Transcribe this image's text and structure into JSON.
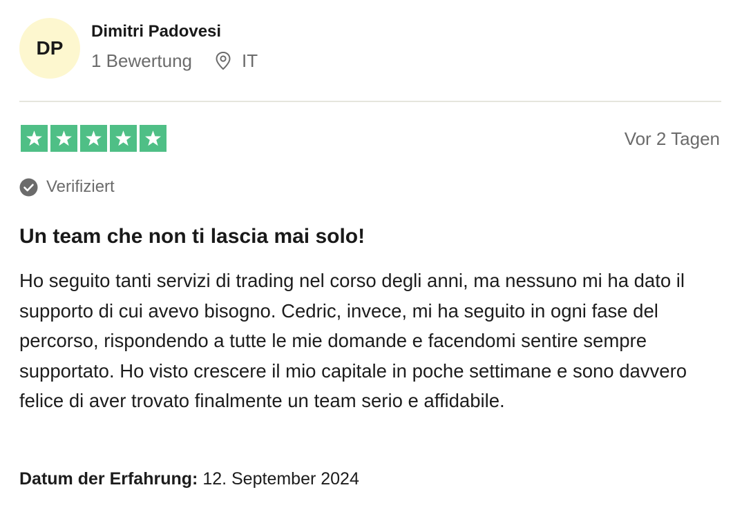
{
  "reviewer": {
    "initials": "DP",
    "name": "Dimitri Padovesi",
    "review_count": "1 Bewertung",
    "country": "IT"
  },
  "review": {
    "rating": 5,
    "max_rating": 5,
    "relative_date": "Vor 2 Tagen",
    "verified_label": "Verifiziert",
    "title": "Un team che non ti lascia mai solo!",
    "text": "Ho seguito tanti servizi di trading nel corso degli anni, ma nessuno mi ha dato il supporto di cui avevo bisogno. Cedric, invece, mi ha seguito in ogni fase del percorso, rispondendo a tutte le mie domande e facendomi sentire sempre supportato. Ho visto crescere il mio capitale in poche settimane e sono davvero felice di aver trovato finalmente un team serio e affidabile.",
    "experience_label": "Datum der Erfahrung:",
    "experience_date": "12. September 2024"
  },
  "colors": {
    "star_green": "#4fbf86",
    "avatar_bg": "#fdf7cf",
    "muted_text": "#6b6b6b"
  },
  "icons": {
    "location": "location-pin-icon",
    "verified": "check-circle-icon",
    "star": "star-icon"
  }
}
